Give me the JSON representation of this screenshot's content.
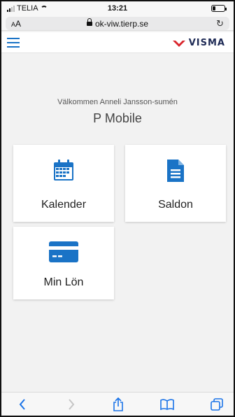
{
  "status_bar": {
    "carrier": "TELIA",
    "time": "13:21"
  },
  "browser": {
    "text_size_label": "AA",
    "url": "ok-viw.tierp.se"
  },
  "header": {
    "logo_text": "VISMA",
    "brand_color": "#1a73c6",
    "logo_accent_color": "#d9252c"
  },
  "main": {
    "welcome": "Välkommen Anneli Jansson-sumén",
    "title": "P Mobile",
    "tiles": [
      {
        "label": "Kalender",
        "icon": "calendar-icon"
      },
      {
        "label": "Saldon",
        "icon": "document-icon"
      },
      {
        "label": "Min Lön",
        "icon": "credit-card-icon"
      }
    ]
  },
  "toolbar": {
    "items": [
      {
        "icon": "back-icon",
        "enabled": true
      },
      {
        "icon": "forward-icon",
        "enabled": false
      },
      {
        "icon": "share-icon",
        "enabled": true
      },
      {
        "icon": "bookmarks-icon",
        "enabled": true
      },
      {
        "icon": "tabs-icon",
        "enabled": true
      }
    ]
  }
}
